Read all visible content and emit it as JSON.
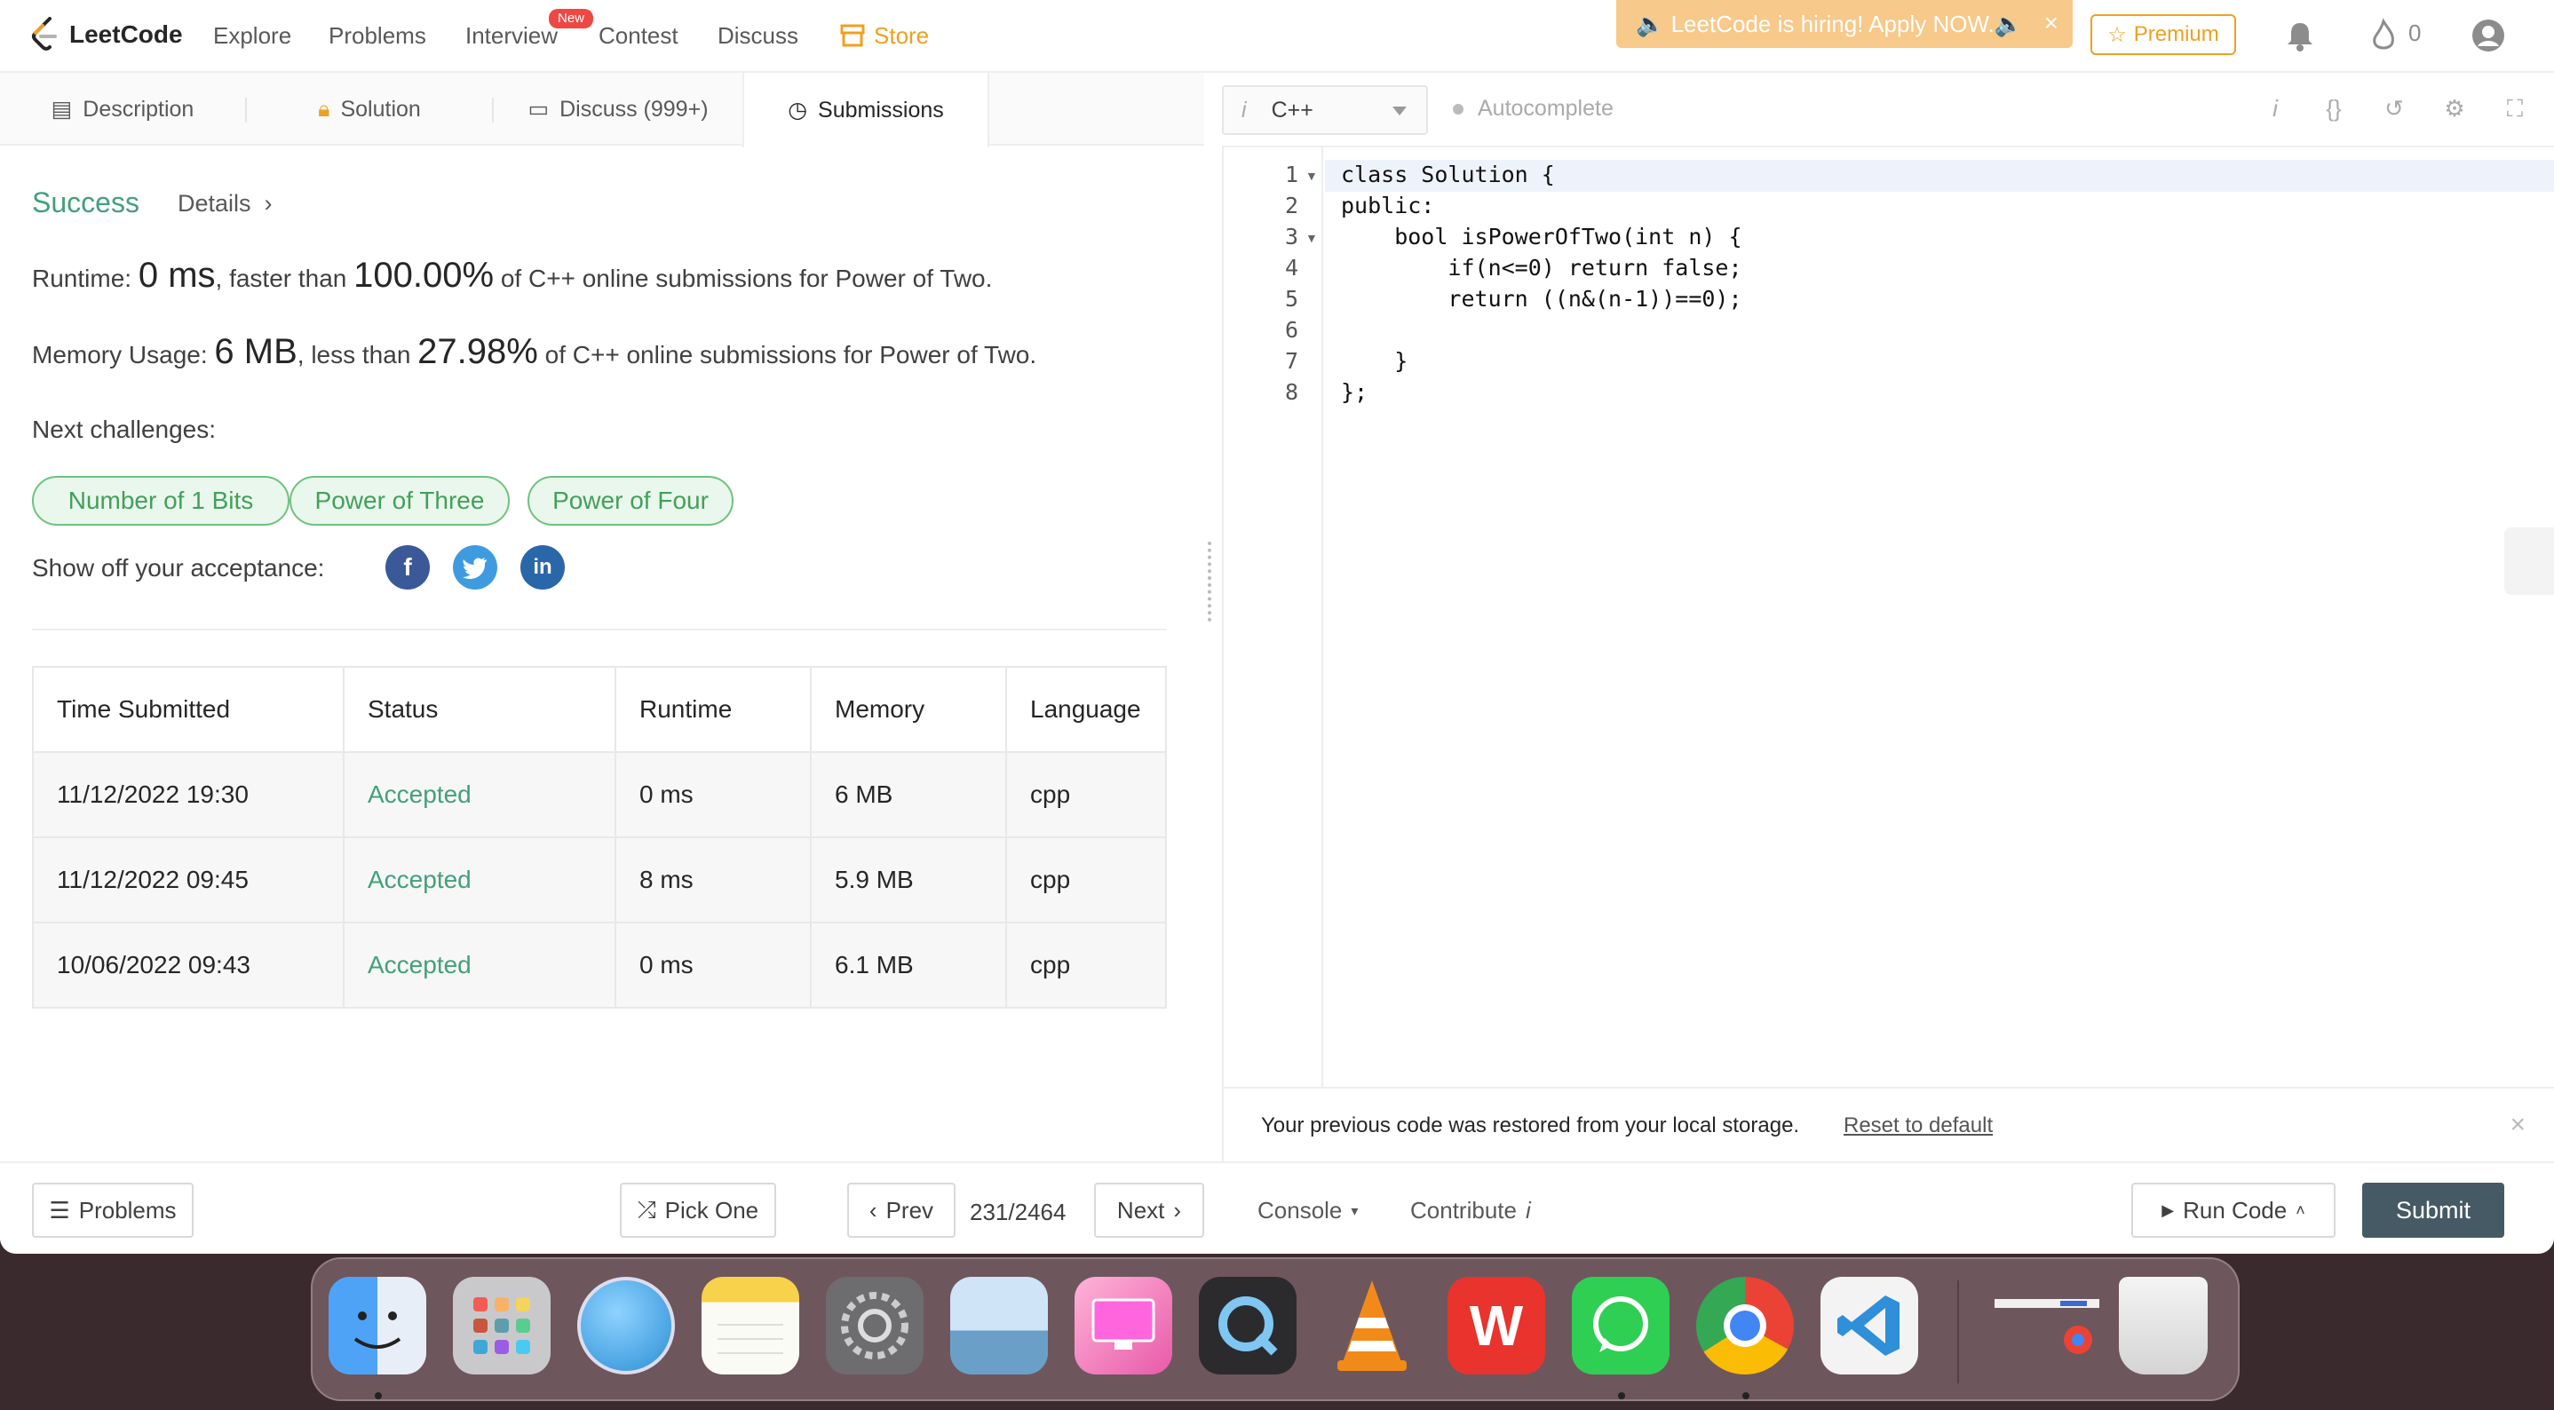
{
  "nav": {
    "logo_text": "LeetCode",
    "items": [
      "Explore",
      "Problems",
      "Interview",
      "Contest",
      "Discuss"
    ],
    "new_badge": "New",
    "store": "Store",
    "hiring_banner": "🔈 LeetCode is hiring! Apply NOW.🔈",
    "premium": "Premium",
    "streak_count": "0"
  },
  "tabs": {
    "description": "Description",
    "solution": "Solution",
    "discuss": "Discuss (999+)",
    "submissions": "Submissions"
  },
  "result": {
    "status": "Success",
    "details": "Details",
    "runtime_label": "Runtime: ",
    "runtime_value": "0 ms",
    "runtime_mid": ", faster than ",
    "runtime_pct": "100.00%",
    "runtime_tail": " of C++ online submissions for Power of Two.",
    "memory_label": "Memory Usage: ",
    "memory_value": "6 MB",
    "memory_mid": ", less than ",
    "memory_pct": "27.98%",
    "memory_tail": " of C++ online submissions for Power of Two.",
    "next_label": "Next challenges:",
    "challenges": [
      "Number of 1 Bits",
      "Power of Three",
      "Power of Four"
    ],
    "show_off": "Show off your acceptance:"
  },
  "submissions_table": {
    "headers": [
      "Time Submitted",
      "Status",
      "Runtime",
      "Memory",
      "Language"
    ],
    "rows": [
      [
        "11/12/2022 19:30",
        "Accepted",
        "0 ms",
        "6 MB",
        "cpp"
      ],
      [
        "11/12/2022 09:45",
        "Accepted",
        "8 ms",
        "5.9 MB",
        "cpp"
      ],
      [
        "10/06/2022 09:43",
        "Accepted",
        "0 ms",
        "6.1 MB",
        "cpp"
      ]
    ]
  },
  "editor": {
    "language": "C++",
    "autocomplete": "Autocomplete",
    "line_numbers": [
      "1",
      "2",
      "3",
      "4",
      "5",
      "6",
      "7",
      "8"
    ],
    "code_lines": [
      "class Solution {",
      "public:",
      "    bool isPowerOfTwo(int n) {",
      "        if(n<=0) return false;",
      "        return ((n&(n-1))==0);",
      "",
      "    }",
      "};"
    ],
    "restore_msg": "Your previous code was restored from your local storage.",
    "reset_link": "Reset to default"
  },
  "bottom": {
    "problems": "Problems",
    "pick_one": "Pick One",
    "prev": "Prev",
    "page": "231/2464",
    "next": "Next",
    "console": "Console",
    "contribute": "Contribute",
    "run_code": "Run Code",
    "submit": "Submit"
  },
  "dock": {
    "apps": [
      "finder-icon",
      "launchpad-icon",
      "safari-like-icon",
      "notes-icon",
      "system-settings-icon",
      "preview-icon",
      "cleanmymac-icon",
      "quicktime-icon",
      "vlc-icon",
      "wps-icon",
      "whatsapp-icon",
      "chrome-icon",
      "vscode-icon"
    ]
  },
  "colors": {
    "accent_green": "#43a07b",
    "brand_orange": "#f0a020",
    "submit_bg": "#455a64"
  }
}
